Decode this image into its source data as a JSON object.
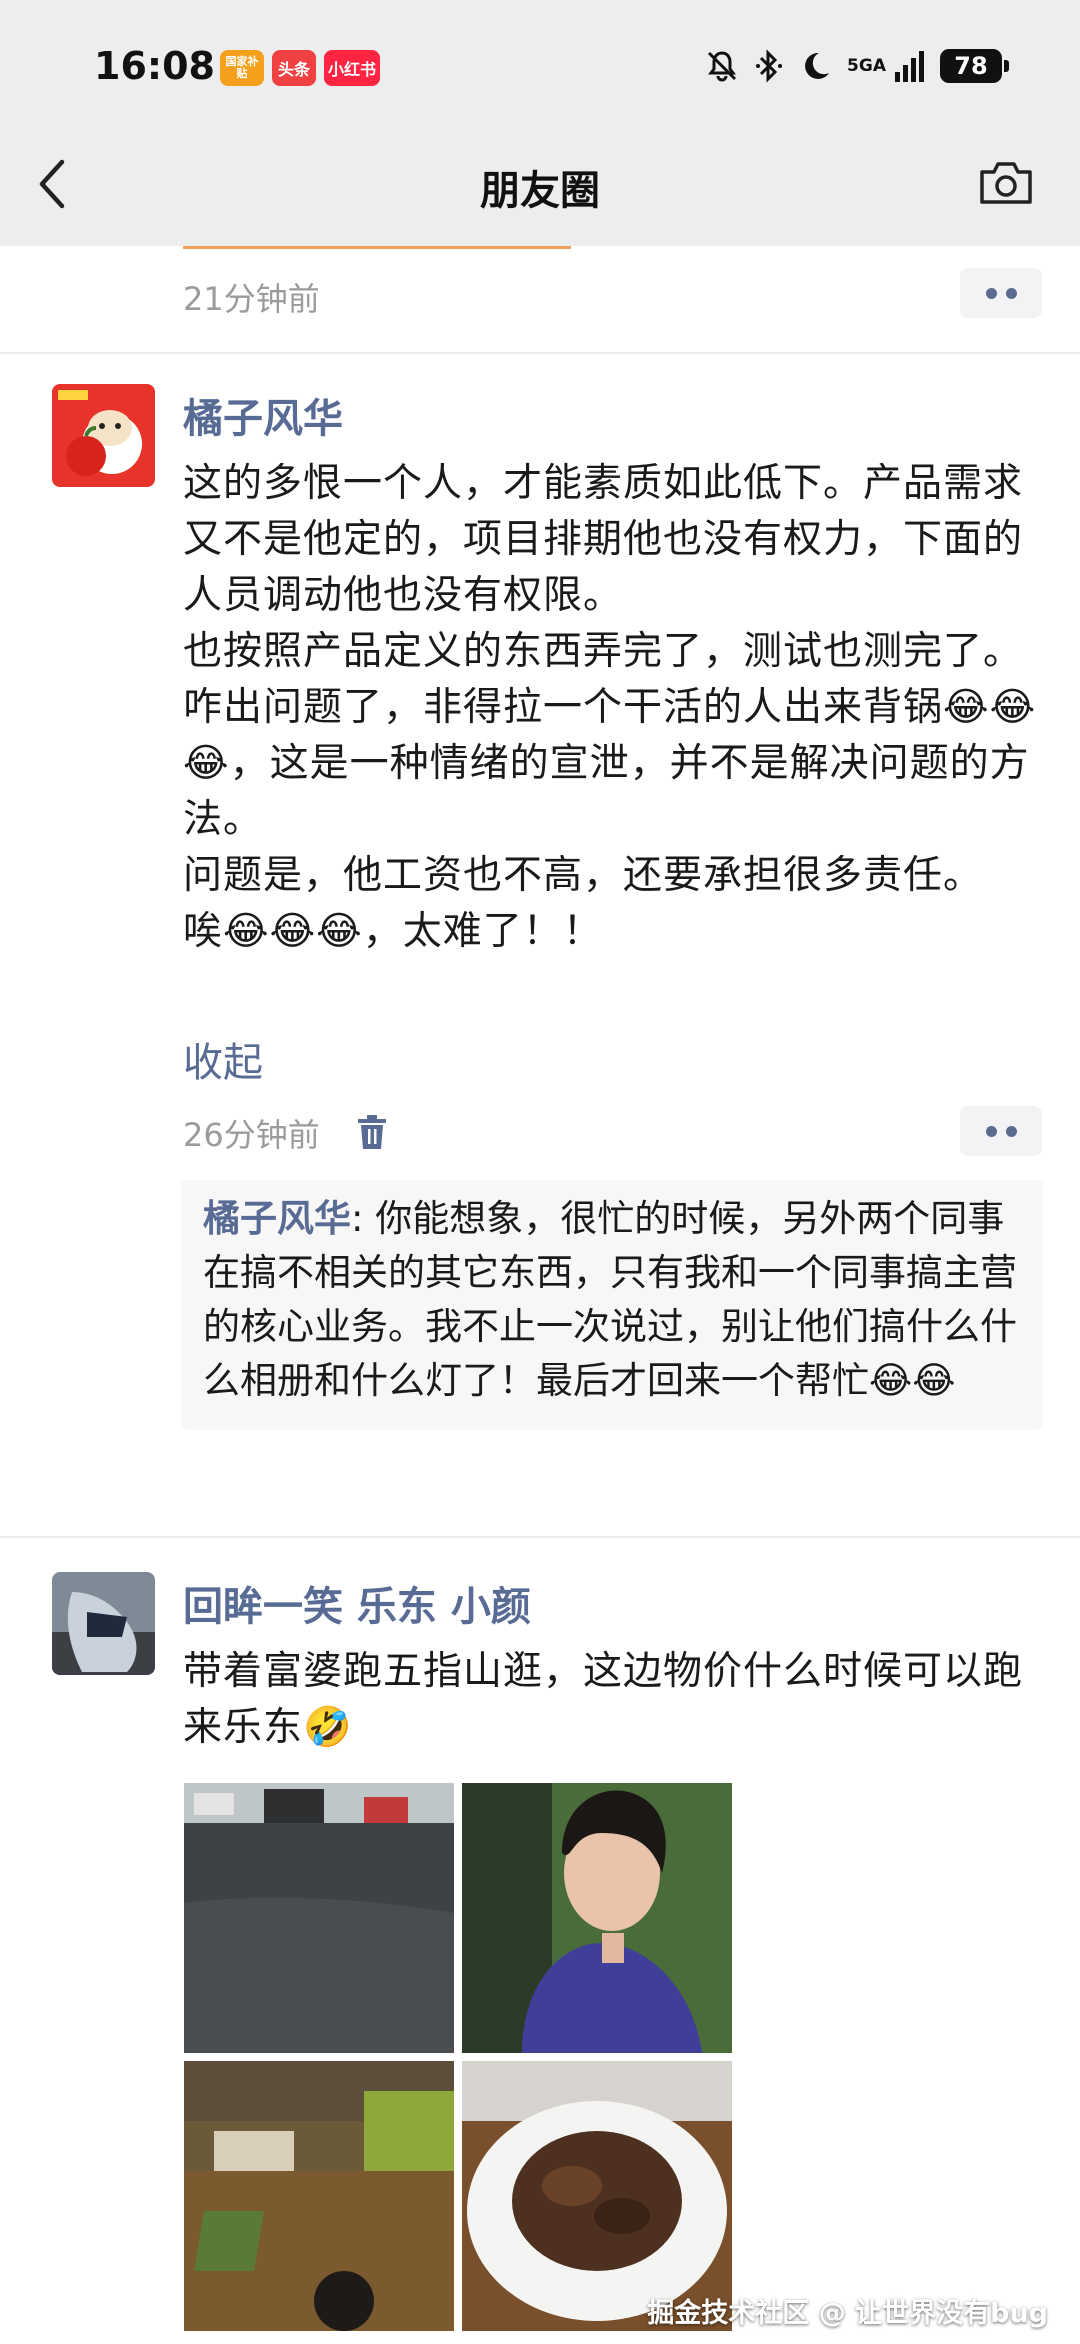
{
  "status_bar": {
    "time": "16:08",
    "app_badges": [
      "国家补贴",
      "头条",
      "小红书"
    ],
    "icons": [
      "mute-bell-icon",
      "bluetooth-icon",
      "moon-icon",
      "signal-5g-icon"
    ],
    "signal_label": "5GA",
    "battery": "78"
  },
  "nav": {
    "title": "朋友圈",
    "back_icon": "chevron-left-icon",
    "camera_icon": "camera-icon"
  },
  "post1_tail": {
    "time": "21分钟前"
  },
  "post2": {
    "author": "橘子风华",
    "text": "这的多恨一个人，才能素质如此低下。产品需求又不是他定的，项目排期他也没有权力，下面的人员调动他也没有权限。\n也按照产品定义的东西弄完了，测试也测完了。咋出问题了，非得拉一个干活的人出来背锅😂😂😂，这是一种情绪的宣泄，并不是解决问题的方法。\n问题是，他工资也不高，还要承担很多责任。\n唉😂😂😂，太难了！！",
    "collapse_label": "收起",
    "time": "26分钟前",
    "comment": {
      "name": "橘子风华",
      "text": ": 你能想象，很忙的时候，另外两个同事在搞不相关的其它东西，只有我和一个同事搞主营的核心业务。我不止一次说过，别让他们搞什么什么相册和什么灯了！最后才回来一个帮忙😂😂"
    }
  },
  "post3": {
    "author": "回眸一笑 乐东 小颜",
    "text": "带着富婆跑五指山逛，这边物价什么时候可以跑来乐东🤣",
    "photos": [
      "street-photo",
      "portrait-photo",
      "longan-market-photo",
      "fried-food-photo"
    ]
  },
  "watermark": "掘金技术社区 @ 让世界没有bug"
}
